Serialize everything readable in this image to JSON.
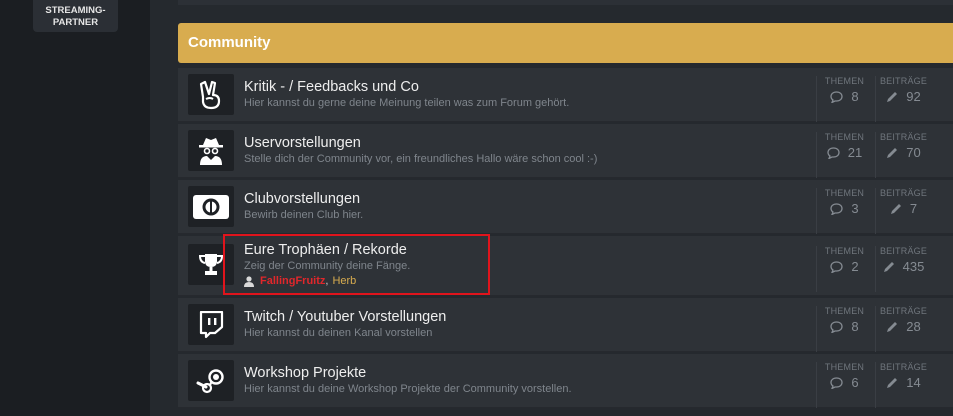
{
  "sidebar": {
    "streaming_line1": "STREAMING-",
    "streaming_line2": "PARTNER"
  },
  "category": {
    "title": "Community"
  },
  "stat_labels": {
    "themes": "THEMEN",
    "posts": "BEITRÄGE"
  },
  "forums": [
    {
      "title": "Kritik - / Feedbacks und Co",
      "description": "Hier kannst du gerne deine Meinung teilen was zum Forum gehört.",
      "themes": "8",
      "posts": "92",
      "icon": "peace-hand-icon"
    },
    {
      "title": "Uservorstellungen",
      "description": "Stelle dich der Community vor, ein freundliches Hallo wäre schon cool :-)",
      "themes": "21",
      "posts": "70",
      "icon": "spy-user-icon"
    },
    {
      "title": "Clubvorstellungen",
      "description": "Bewirb deinen Club hier.",
      "themes": "3",
      "posts": "7",
      "icon": "club-card-icon"
    },
    {
      "title": "Eure Trophäen / Rekorde",
      "description": "Zeig der Community deine Fänge.",
      "themes": "2",
      "posts": "435",
      "icon": "trophy-icon",
      "online_users": [
        "FallingFruitz",
        "Herb"
      ]
    },
    {
      "title": "Twitch / Youtuber Vorstellungen",
      "description": "Hier kannst du deinen Kanal vorstellen",
      "themes": "8",
      "posts": "28",
      "icon": "twitch-icon"
    },
    {
      "title": "Workshop Projekte",
      "description": "Hier kannst du deine Workshop Projekte der Community vorstellen.",
      "themes": "6",
      "posts": "14",
      "icon": "steam-icon"
    }
  ],
  "colors": {
    "category_header": "#d8ac4f",
    "user_red": "#e0272b",
    "user_gold": "#d8ac4f",
    "highlight_box": "#e0141c"
  }
}
